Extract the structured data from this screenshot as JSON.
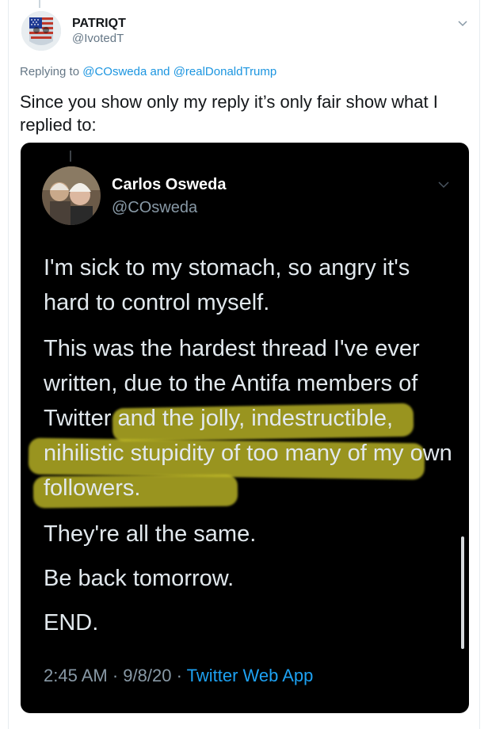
{
  "tweet": {
    "author_name": "PATRIQT",
    "author_handle": "@IvotedT",
    "reply_prefix": "Replying to ",
    "reply_to_1": "@COsweda",
    "reply_and": " and ",
    "reply_to_2": "@realDonaldTrump",
    "text": "Since you show only my reply it’s only fair show what I replied to:"
  },
  "screenshot": {
    "author_name": "Carlos Osweda",
    "author_handle": "@COsweda",
    "paragraphs": [
      "I'm sick to my stomach, so angry it's hard to control myself.",
      "This was the hardest thread I've ever written, due to the Antifa members of Twitter and the jolly, indestructible, nihilistic stupidity of too many of my own followers.",
      "They're all the same.",
      "Be back tomorrow.",
      "END."
    ],
    "time": "2:45 AM",
    "date": "9/8/20",
    "sep": " · ",
    "app": "Twitter Web App"
  },
  "colors": {
    "accent_link": "#1b95e0",
    "highlight": "#c4be28",
    "screenshot_bg": "#000000"
  },
  "icons": {
    "more": "chevron-down-icon",
    "avatar_main": "punisher-skull-flag-avatar",
    "avatar_inner": "two-person-photo-avatar"
  }
}
